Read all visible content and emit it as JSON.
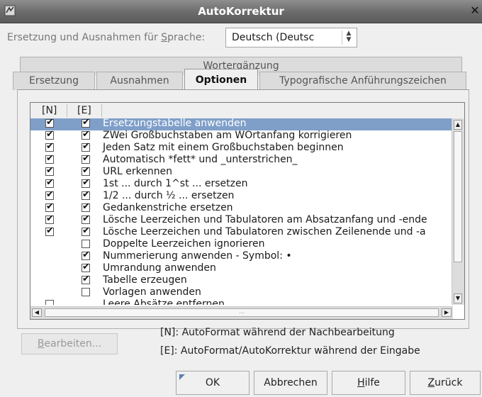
{
  "window": {
    "title": "AutoKorrektur",
    "close_label": "✕"
  },
  "language": {
    "label_before": "Ersetzung und Ausnahmen für ",
    "label_mnemonic": "S",
    "label_after": "prache:",
    "value": "Deutsch (Deutsc"
  },
  "tabs_top": [
    {
      "label": "Wortergänzung"
    }
  ],
  "tabs_bottom": [
    {
      "label": "Ersetzung",
      "active": false
    },
    {
      "label": "Ausnahmen",
      "active": false
    },
    {
      "label": "Optionen",
      "active": true
    },
    {
      "label": "Typografische Anführungszeichen",
      "active": false
    }
  ],
  "list": {
    "col_n": "[N]",
    "col_e": "[E]",
    "rows": [
      {
        "n": true,
        "e": true,
        "text": "Ersetzungstabelle anwenden",
        "selected": true
      },
      {
        "n": true,
        "e": true,
        "text": "ZWei Großbuchstaben am WOrtanfang korrigieren"
      },
      {
        "n": true,
        "e": true,
        "text": "Jeden Satz mit einem Großbuchstaben beginnen"
      },
      {
        "n": true,
        "e": true,
        "text": "Automatisch *fett* und _unterstrichen_"
      },
      {
        "n": true,
        "e": true,
        "text": "URL erkennen"
      },
      {
        "n": true,
        "e": true,
        "text": "1st ... durch 1^st ... ersetzen"
      },
      {
        "n": true,
        "e": true,
        "text": "1/2 ... durch ½ ... ersetzen"
      },
      {
        "n": true,
        "e": true,
        "text": "Gedankenstriche ersetzen"
      },
      {
        "n": true,
        "e": true,
        "text": "Lösche Leerzeichen und Tabulatoren am Absatzanfang und -ende"
      },
      {
        "n": true,
        "e": true,
        "text": "Lösche Leerzeichen und Tabulatoren zwischen Zeilenende und -a"
      },
      {
        "n": null,
        "e": false,
        "text": "Doppelte Leerzeichen ignorieren"
      },
      {
        "n": null,
        "e": true,
        "text": "Nummerierung anwenden - Symbol: •"
      },
      {
        "n": null,
        "e": true,
        "text": "Umrandung anwenden"
      },
      {
        "n": null,
        "e": true,
        "text": "Tabelle erzeugen"
      },
      {
        "n": null,
        "e": false,
        "text": "Vorlagen anwenden"
      },
      {
        "n": false,
        "e": null,
        "text": "Leere Absätze entfernen"
      }
    ],
    "hscroll_dots": "..."
  },
  "edit_button": {
    "mnemonic": "B",
    "rest": "earbeiten..."
  },
  "legend": {
    "n": "[N]: AutoFormat während der Nachbearbeitung",
    "e": "[E]: AutoFormat/AutoKorrektur während der Eingabe"
  },
  "buttons": {
    "ok": "OK",
    "cancel": "Abbrechen",
    "help_mnemonic": "H",
    "help_rest": "ilfe",
    "back_mnemonic": "Z",
    "back_rest": "urück"
  },
  "colors": {
    "selection": "#7f9fc9",
    "titlebar": "#6b6b6b"
  }
}
